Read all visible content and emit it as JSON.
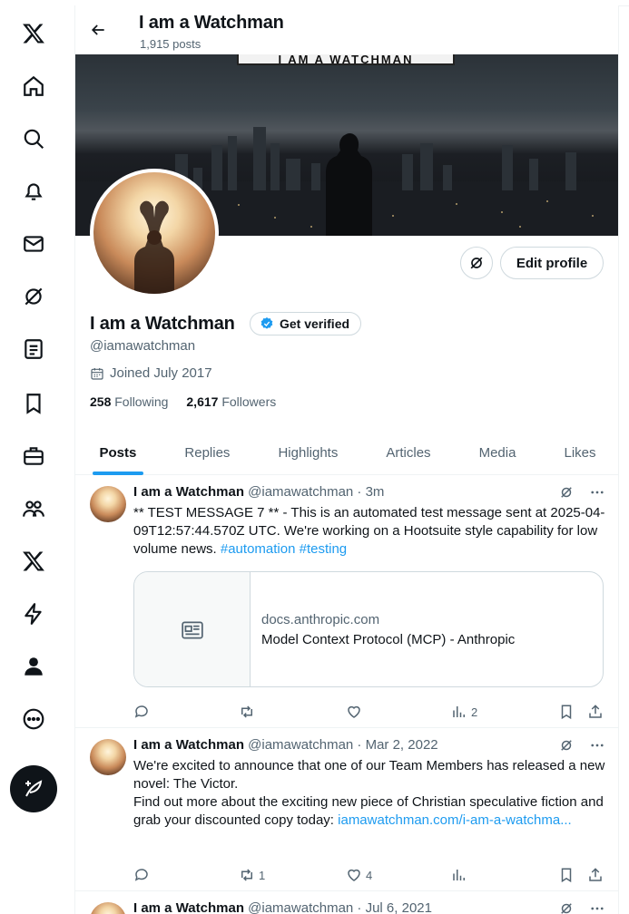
{
  "header": {
    "title": "I am a Watchman",
    "subtitle": "1,915 posts"
  },
  "banner": {
    "sign_text": "I AM A WATCHMAN"
  },
  "profile": {
    "edit_label": "Edit profile",
    "name": "I am a Watchman",
    "verified_label": "Get verified",
    "handle": "@iamawatchman",
    "joined": "Joined July 2017",
    "following_count": "258",
    "following_label": "Following",
    "followers_count": "2,617",
    "followers_label": "Followers"
  },
  "tabs": [
    {
      "label": "Posts",
      "active": true
    },
    {
      "label": "Replies"
    },
    {
      "label": "Highlights"
    },
    {
      "label": "Articles"
    },
    {
      "label": "Media"
    },
    {
      "label": "Likes"
    }
  ],
  "posts": [
    {
      "name": "I am a Watchman",
      "meta": "@iamawatchman · 3m",
      "text_1": "** TEST MESSAGE 7 ** - This is an automated test message sent at 2025-04-09T12:57:44.570Z UTC. We're working on a Hootsuite style capability for low volume news. ",
      "hashtag_1": "#automation",
      "hashtag_2": "#testing",
      "card_domain": "docs.anthropic.com",
      "card_title": "Model Context Protocol (MCP) - Anthropic",
      "views": "2"
    },
    {
      "name": "I am a Watchman",
      "meta": "@iamawatchman · Mar 2, 2022",
      "text_1": "We're excited to announce that one of our Team Members has released a new novel: The Victor.",
      "text_2": "Find out more about the exciting new piece of Christian speculative fiction and grab your discounted copy today: ",
      "link": "iamawatchman.com/i-am-a-watchma...",
      "reposts": "1",
      "likes": "4"
    },
    {
      "name": "I am a Watchman",
      "meta": "@iamawatchman · Jul 6, 2021"
    }
  ],
  "colors": {
    "accent": "#1d9bf0",
    "text": "#0f1419",
    "muted": "#536471",
    "border": "#eff3f4"
  }
}
